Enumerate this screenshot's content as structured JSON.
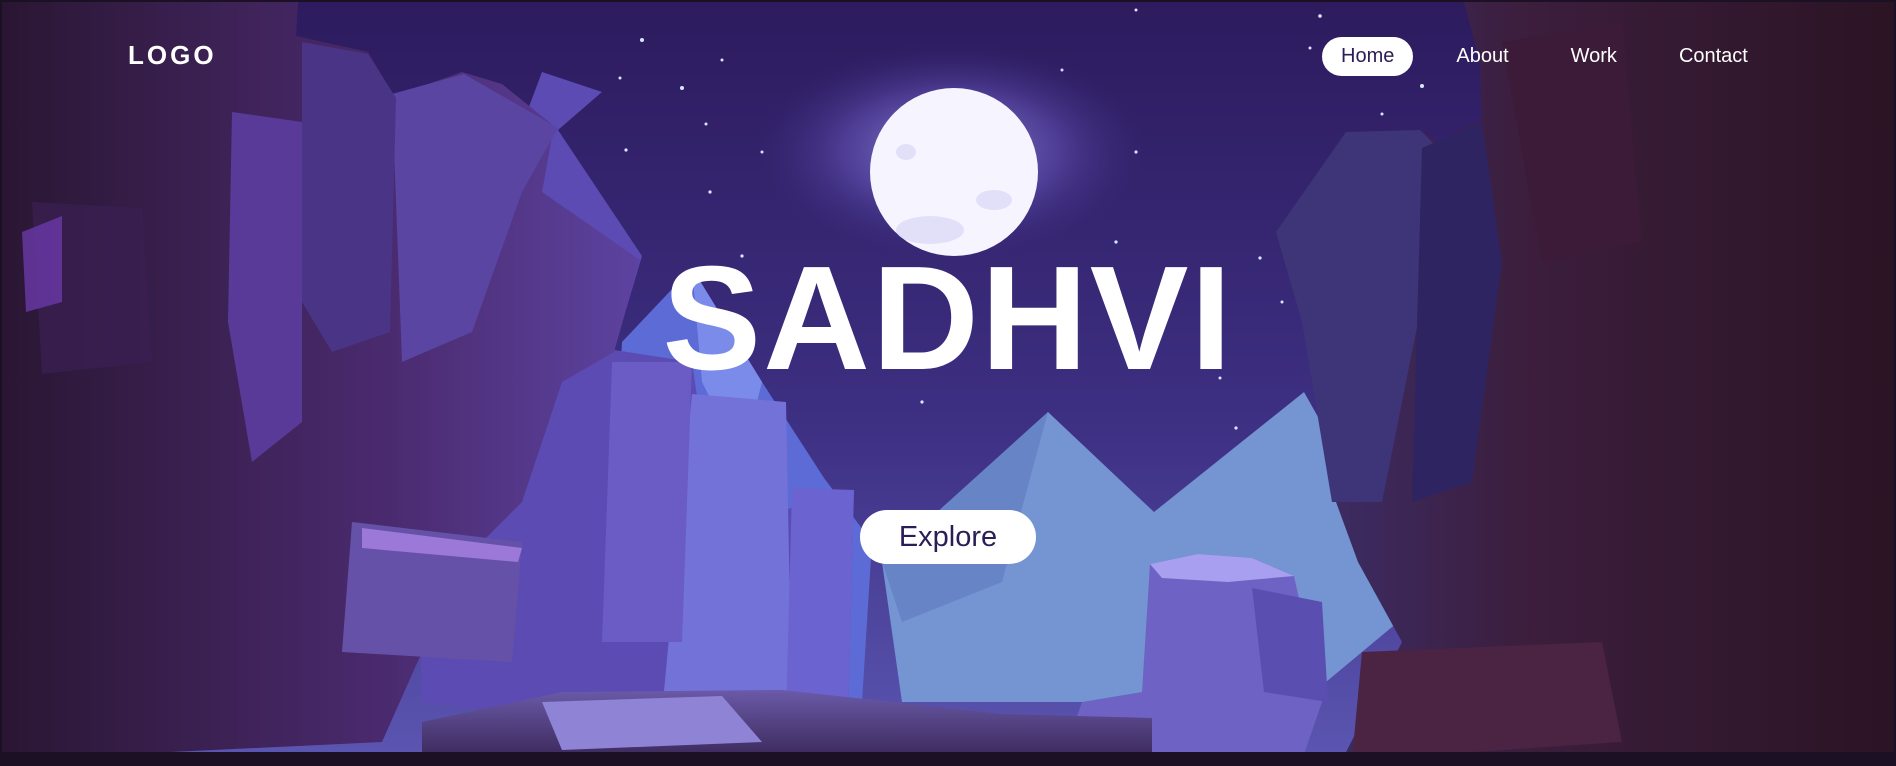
{
  "brand": {
    "logo_text": "LOGO"
  },
  "nav": {
    "items": [
      {
        "label": "Home",
        "active": true
      },
      {
        "label": "About",
        "active": false
      },
      {
        "label": "Work",
        "active": false
      },
      {
        "label": "Contact",
        "active": false
      }
    ]
  },
  "hero": {
    "title": "SADHVI",
    "cta_label": "Explore"
  },
  "colors": {
    "sky_top": "#2f1d63",
    "sky_bottom": "#5a4aa8",
    "moon": "#f4f3ff",
    "cliff_dark": "#2a1836",
    "cliff_mid": "#5b3f93",
    "rock_light": "#7d72d8",
    "mountain_far": "#6f8fd0",
    "text": "#ffffff",
    "cta_text": "#2b1d55"
  }
}
